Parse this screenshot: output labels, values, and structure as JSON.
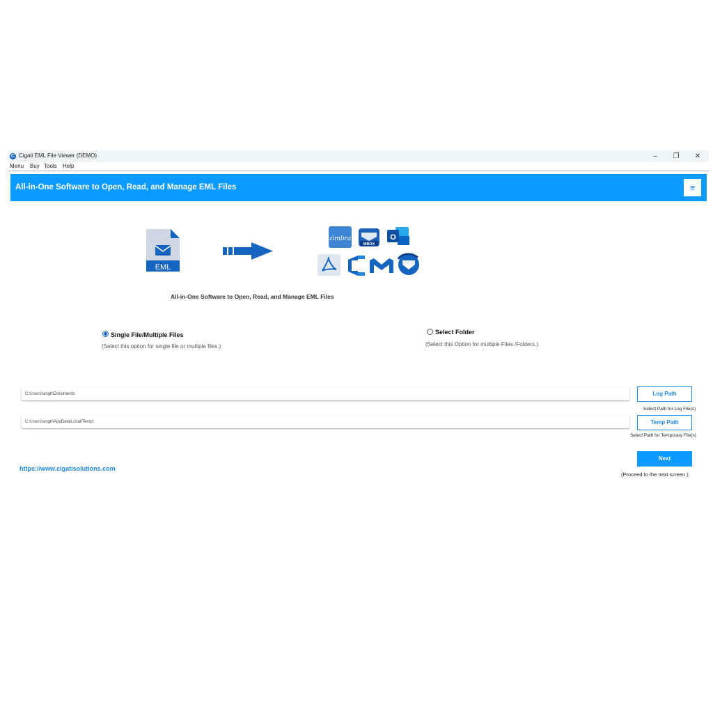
{
  "window": {
    "title": "Cigati EML File Viewer (DEMO)",
    "app_icon_glyph": "C",
    "controls": {
      "minimize": "–",
      "restore": "❐",
      "close": "✕"
    }
  },
  "menubar": {
    "items": [
      "Menu",
      "Buy",
      "Tools",
      "Help"
    ]
  },
  "banner": {
    "title": "All-in-One Software to Open, Read, and Manage EML Files",
    "menu_glyph": "≡"
  },
  "hero": {
    "source_label": "EML",
    "target_labels": {
      "zimbra": "zimbra",
      "mbox": "MBOX",
      "outlook": "O"
    },
    "tagline": "All-in-One Software to Open, Read, and Manage EML Files"
  },
  "options": {
    "single": {
      "label": "Single File/Multiple Files",
      "description": "(Select this option for single file or multiple files.)",
      "selected": true
    },
    "folder": {
      "label": "Select Folder",
      "description": "(Select this Option for multiple Files /Folders.)",
      "selected": false
    }
  },
  "paths": {
    "log": {
      "value": "C:\\Users\\singh\\Documents",
      "button": "Log Path",
      "hint": "Select Path for Log File(s)"
    },
    "temp": {
      "value": "C:\\Users\\singh\\AppData\\Local\\Temp\\",
      "button": "Temp Path",
      "hint": "Select Path for Temporary File(s)"
    }
  },
  "footer": {
    "website": "https://www.cigatisolutions.com",
    "next_button": "Next",
    "next_hint": "(Proceed to the next screen.)"
  },
  "colors": {
    "accent": "#0b9aff",
    "link": "#1e88e5",
    "icon_blue": "#1565c0"
  }
}
